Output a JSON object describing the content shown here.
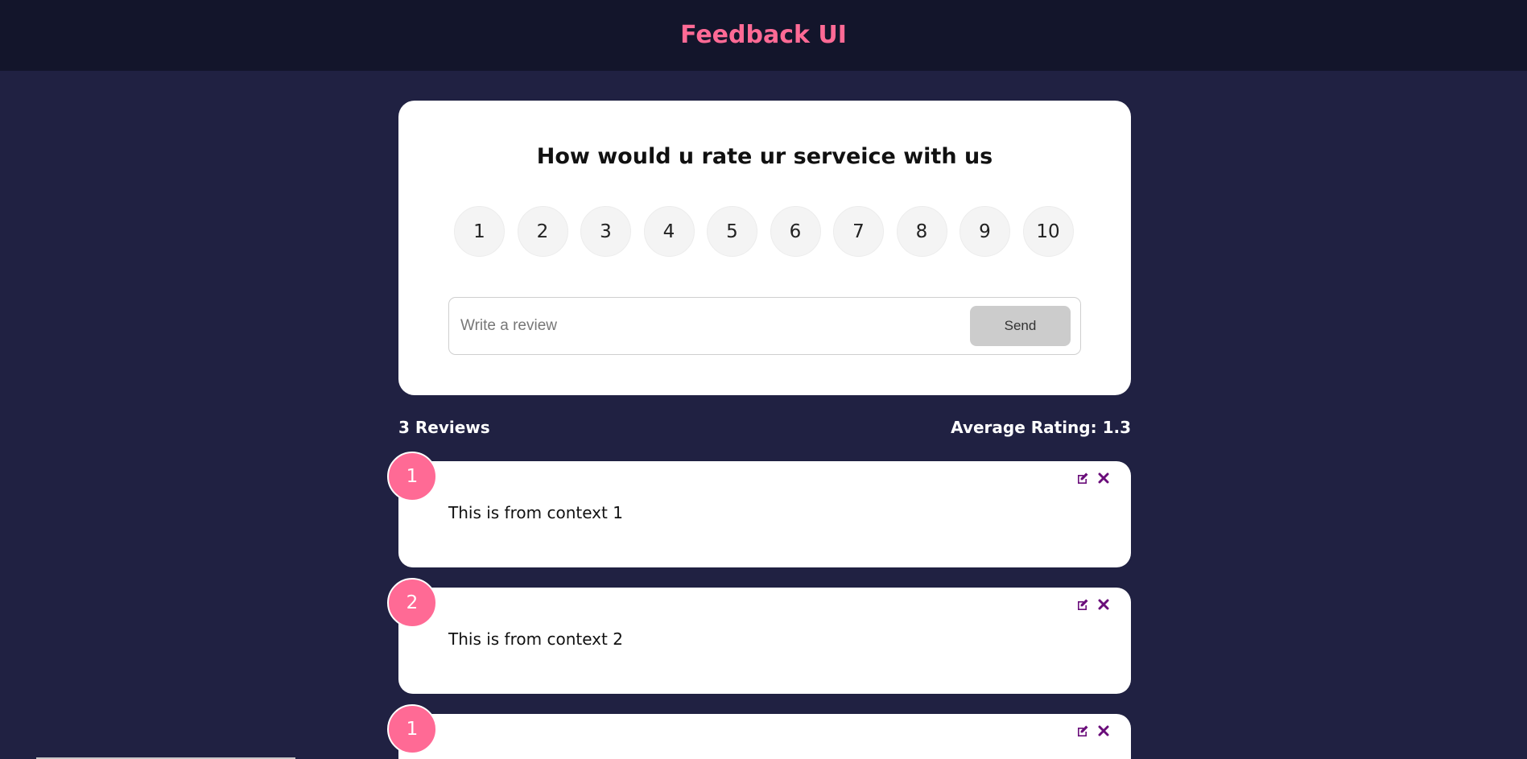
{
  "header": {
    "title": "Feedback UI"
  },
  "rating_form": {
    "question": "How would u rate ur serveice with us",
    "options": [
      "1",
      "2",
      "3",
      "4",
      "5",
      "6",
      "7",
      "8",
      "9",
      "10"
    ],
    "review_placeholder": "Write a review",
    "send_label": "Send"
  },
  "stats": {
    "count_label": "3 Reviews",
    "average_label": "Average Rating: 1.3"
  },
  "reviews": [
    {
      "rating": "1",
      "text": "This is from context 1"
    },
    {
      "rating": "2",
      "text": "This is from context 2"
    },
    {
      "rating": "1",
      "text": ""
    }
  ],
  "icons": {
    "edit": "edit-icon",
    "delete": "close-icon"
  },
  "colors": {
    "accent": "#ff6a95",
    "background": "#202142",
    "header_background": "#13152b",
    "icon": "#6a0d7a"
  }
}
